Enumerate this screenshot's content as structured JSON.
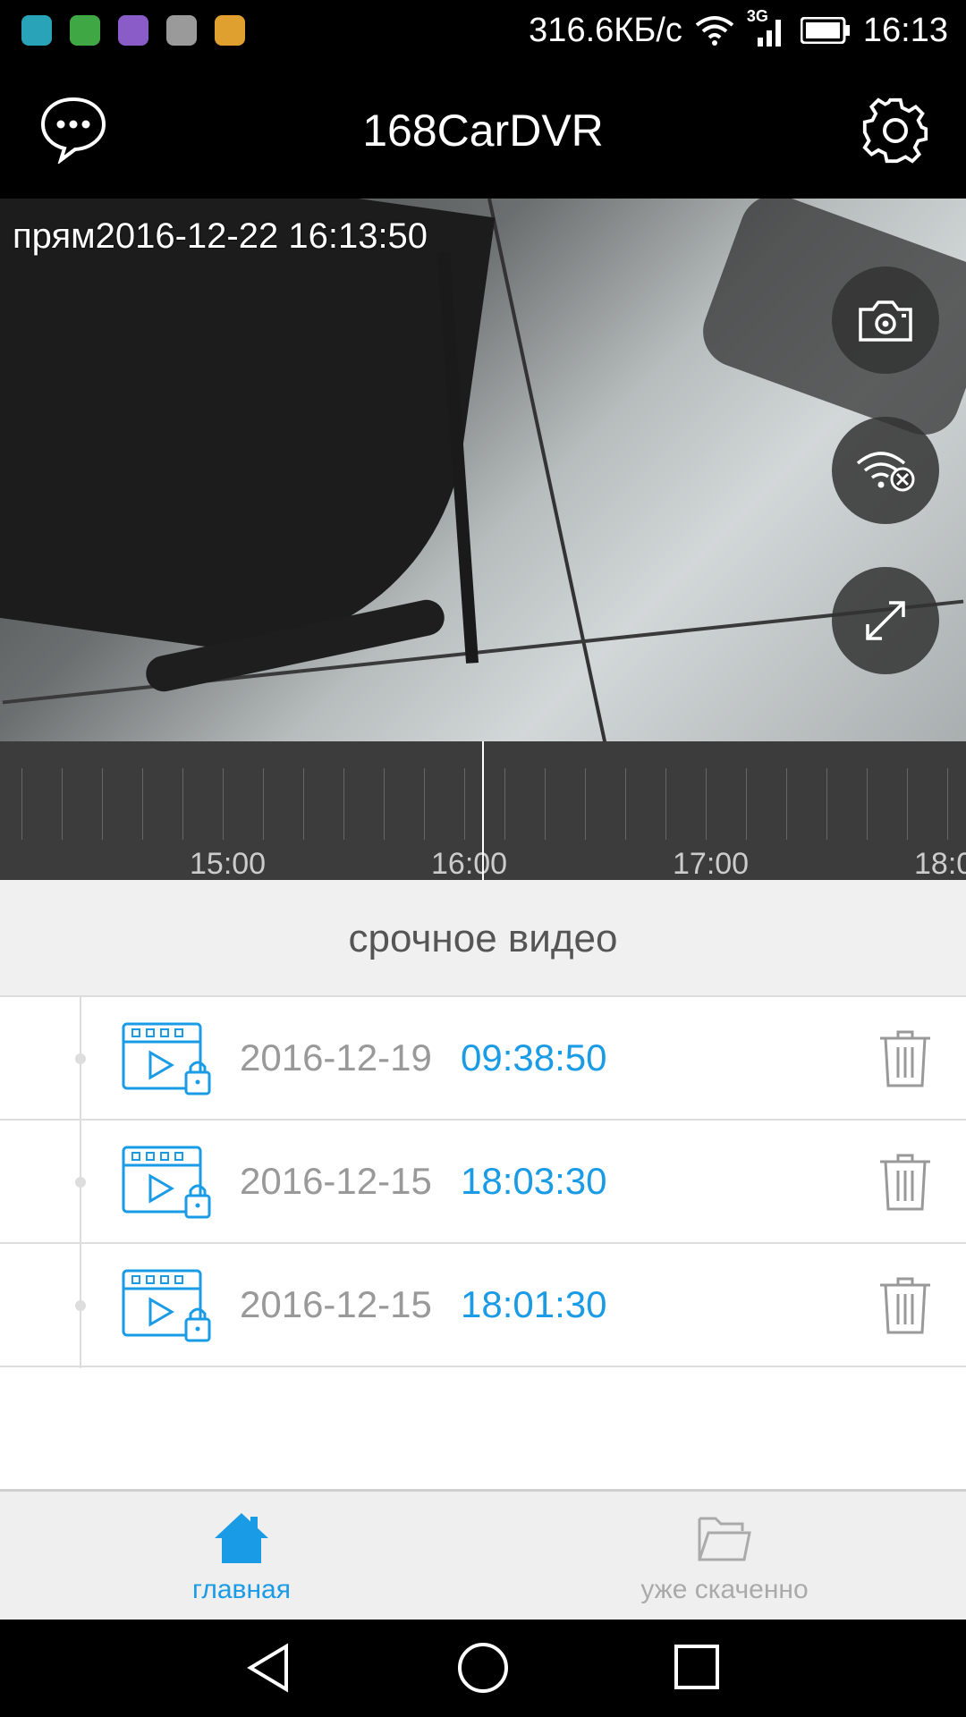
{
  "status_bar": {
    "speed": "316.6КБ/с",
    "network": "3G",
    "time": "16:13",
    "app_icons": [
      {
        "name": "message-app-icon",
        "color": "#29a3b8"
      },
      {
        "name": "shield-app-icon",
        "color": "#3fa845"
      },
      {
        "name": "gallery-app-icon",
        "color": "#8a5cc8"
      },
      {
        "name": "font-app-icon",
        "color": "#9a9a9a"
      },
      {
        "name": "hand-app-icon",
        "color": "#e0a030"
      }
    ]
  },
  "header": {
    "title": "168CarDVR",
    "left_icon": "chat-bubble-icon",
    "right_icon": "gear-icon"
  },
  "video": {
    "timestamp": "прям2016-12-22 16:13:50",
    "buttons": [
      "camera-icon",
      "wifi-off-icon",
      "expand-icon"
    ]
  },
  "timeline": {
    "labels": [
      "15:00",
      "16:00",
      "17:00",
      "18:0"
    ]
  },
  "section": {
    "title": "срочное видео"
  },
  "videos": [
    {
      "date": "2016-12-19",
      "time": "09:38:50"
    },
    {
      "date": "2016-12-15",
      "time": "18:03:30"
    },
    {
      "date": "2016-12-15",
      "time": "18:01:30"
    }
  ],
  "bottom_nav": {
    "home_label": "главная",
    "downloads_label": "уже скаченно",
    "active_color": "#1a9be6",
    "inactive_color": "#aaaaaa"
  }
}
